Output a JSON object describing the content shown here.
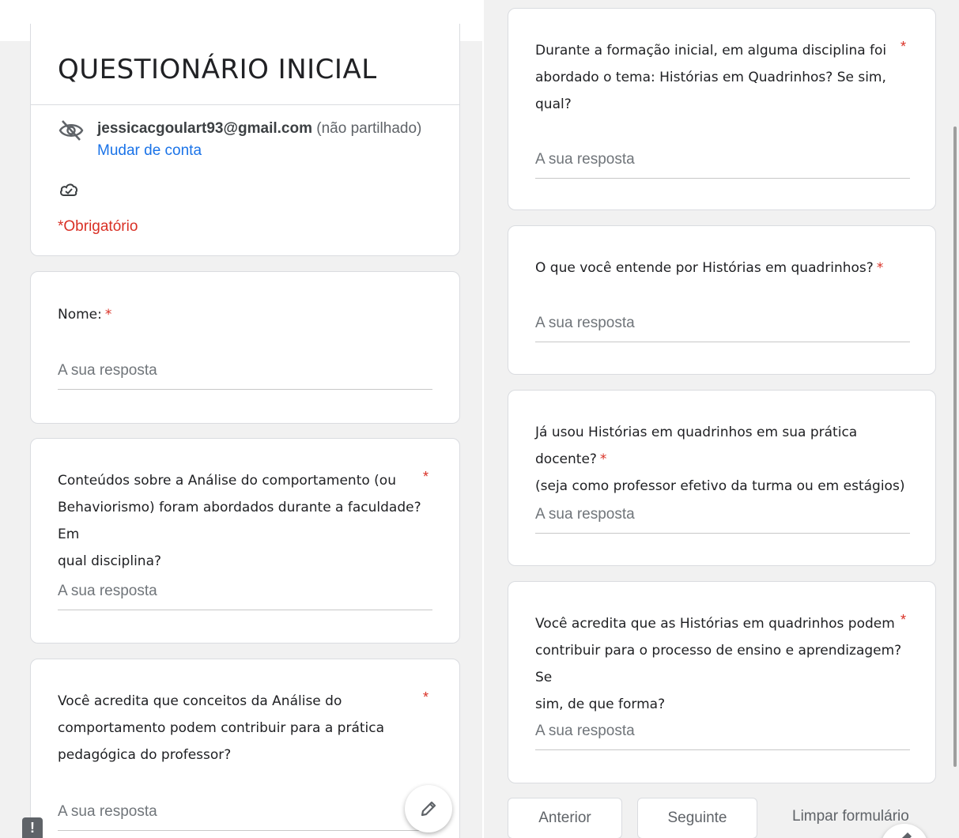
{
  "header": {
    "title": "QUESTIONÁRIO INICIAL",
    "email": "jessicacgoulart93@gmail.com",
    "not_shared": "(não partilhado)",
    "switch_account": "Mudar de conta",
    "required_note": "*Obrigatório"
  },
  "questions": [
    {
      "text": "Nome:",
      "required": "*",
      "placeholder": "A sua resposta"
    },
    {
      "line1": "Conteúdos sobre a Análise do comportamento (ou",
      "line2": "Behaviorismo) foram abordados durante a faculdade? Em",
      "line3": "qual disciplina?",
      "required": "*",
      "placeholder": "A sua resposta"
    },
    {
      "line1": "Você acredita que conceitos da Análise do",
      "line2": "comportamento podem contribuir para a prática",
      "line3": "pedagógica do professor?",
      "required": "*",
      "placeholder": "A sua resposta"
    },
    {
      "line1": "Durante a formação inicial, em alguma disciplina foi",
      "line2": "abordado o tema: Histórias em Quadrinhos? Se sim,",
      "line3": "qual?",
      "required": "*",
      "placeholder": "A sua resposta"
    },
    {
      "text": "O que você entende por Histórias em quadrinhos?",
      "required": "*",
      "placeholder": "A sua resposta"
    },
    {
      "line1": "Já usou Histórias em quadrinhos em sua prática docente?",
      "line2": "(seja como professor efetivo da turma ou em estágios)",
      "required": "*",
      "placeholder": "A sua resposta"
    },
    {
      "line1": "Você acredita que as Histórias em quadrinhos podem",
      "line2": "contribuir para o processo de ensino e aprendizagem? Se",
      "line3": "sim, de que forma?",
      "required": "*",
      "placeholder": "A sua resposta"
    }
  ],
  "nav": {
    "prev": "Anterior",
    "next": "Seguinte",
    "clear": "Limpar formulário"
  },
  "icons": {
    "visibility_off": "eye-off-icon",
    "cloud": "cloud-check-icon",
    "edit": "pencil-icon",
    "feedback": "exclamation-icon"
  },
  "colors": {
    "required": "#d93025",
    "link": "#1a73e8",
    "background": "#f1f1f1"
  }
}
